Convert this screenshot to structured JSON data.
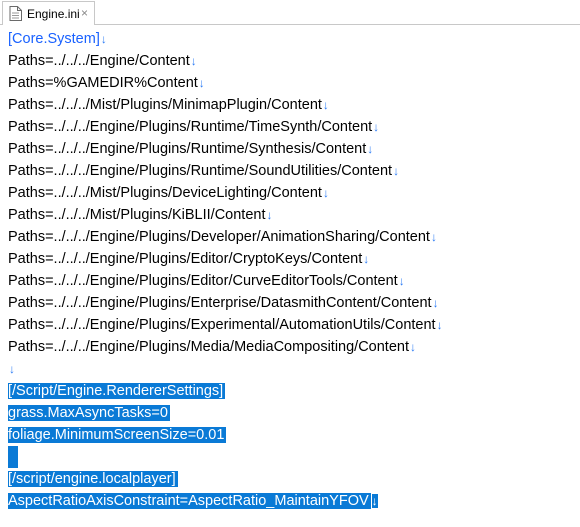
{
  "tab": {
    "label": "Engine.ini",
    "close": "×"
  },
  "eol_mark": "↓",
  "lines": [
    {
      "text": "[Core.System]",
      "kind": "section",
      "selected": false,
      "eol": true
    },
    {
      "text": "Paths=../../../Engine/Content",
      "kind": "plain",
      "selected": false,
      "eol": true
    },
    {
      "text": "Paths=%GAMEDIR%Content",
      "kind": "plain",
      "selected": false,
      "eol": true
    },
    {
      "text": "Paths=../../../Mist/Plugins/MinimapPlugin/Content",
      "kind": "plain",
      "selected": false,
      "eol": true
    },
    {
      "text": "Paths=../../../Engine/Plugins/Runtime/TimeSynth/Content",
      "kind": "plain",
      "selected": false,
      "eol": true
    },
    {
      "text": "Paths=../../../Engine/Plugins/Runtime/Synthesis/Content",
      "kind": "plain",
      "selected": false,
      "eol": true
    },
    {
      "text": "Paths=../../../Engine/Plugins/Runtime/SoundUtilities/Content",
      "kind": "plain",
      "selected": false,
      "eol": true
    },
    {
      "text": "Paths=../../../Mist/Plugins/DeviceLighting/Content",
      "kind": "plain",
      "selected": false,
      "eol": true
    },
    {
      "text": "Paths=../../../Mist/Plugins/KiBLII/Content",
      "kind": "plain",
      "selected": false,
      "eol": true
    },
    {
      "text": "Paths=../../../Engine/Plugins/Developer/AnimationSharing/Content",
      "kind": "plain",
      "selected": false,
      "eol": true
    },
    {
      "text": "Paths=../../../Engine/Plugins/Editor/CryptoKeys/Content",
      "kind": "plain",
      "selected": false,
      "eol": true
    },
    {
      "text": "Paths=../../../Engine/Plugins/Editor/CurveEditorTools/Content",
      "kind": "plain",
      "selected": false,
      "eol": true
    },
    {
      "text": "Paths=../../../Engine/Plugins/Enterprise/DatasmithContent/Content",
      "kind": "plain",
      "selected": false,
      "eol": true
    },
    {
      "text": "Paths=../../../Engine/Plugins/Experimental/AutomationUtils/Content",
      "kind": "plain",
      "selected": false,
      "eol": true
    },
    {
      "text": "Paths=../../../Engine/Plugins/Media/MediaCompositing/Content",
      "kind": "plain",
      "selected": false,
      "eol": true
    },
    {
      "text": "",
      "kind": "plain",
      "selected": false,
      "eol": true
    },
    {
      "text": "[/Script/Engine.RendererSettings]",
      "kind": "section",
      "selected": true,
      "eol": false
    },
    {
      "text": "grass.MaxAsyncTasks=0",
      "kind": "plain",
      "selected": true,
      "eol": false
    },
    {
      "text": "foliage.MinimumScreenSize=0.01",
      "kind": "plain",
      "selected": true,
      "eol": false
    },
    {
      "text": "",
      "kind": "plain",
      "selected": true,
      "eol": false
    },
    {
      "text": "[/script/engine.localplayer]",
      "kind": "section",
      "selected": true,
      "eol": false
    },
    {
      "text": "AspectRatioAxisConstraint=AspectRatio_MaintainYFOV",
      "kind": "plain",
      "selected": true,
      "eol": true
    }
  ]
}
